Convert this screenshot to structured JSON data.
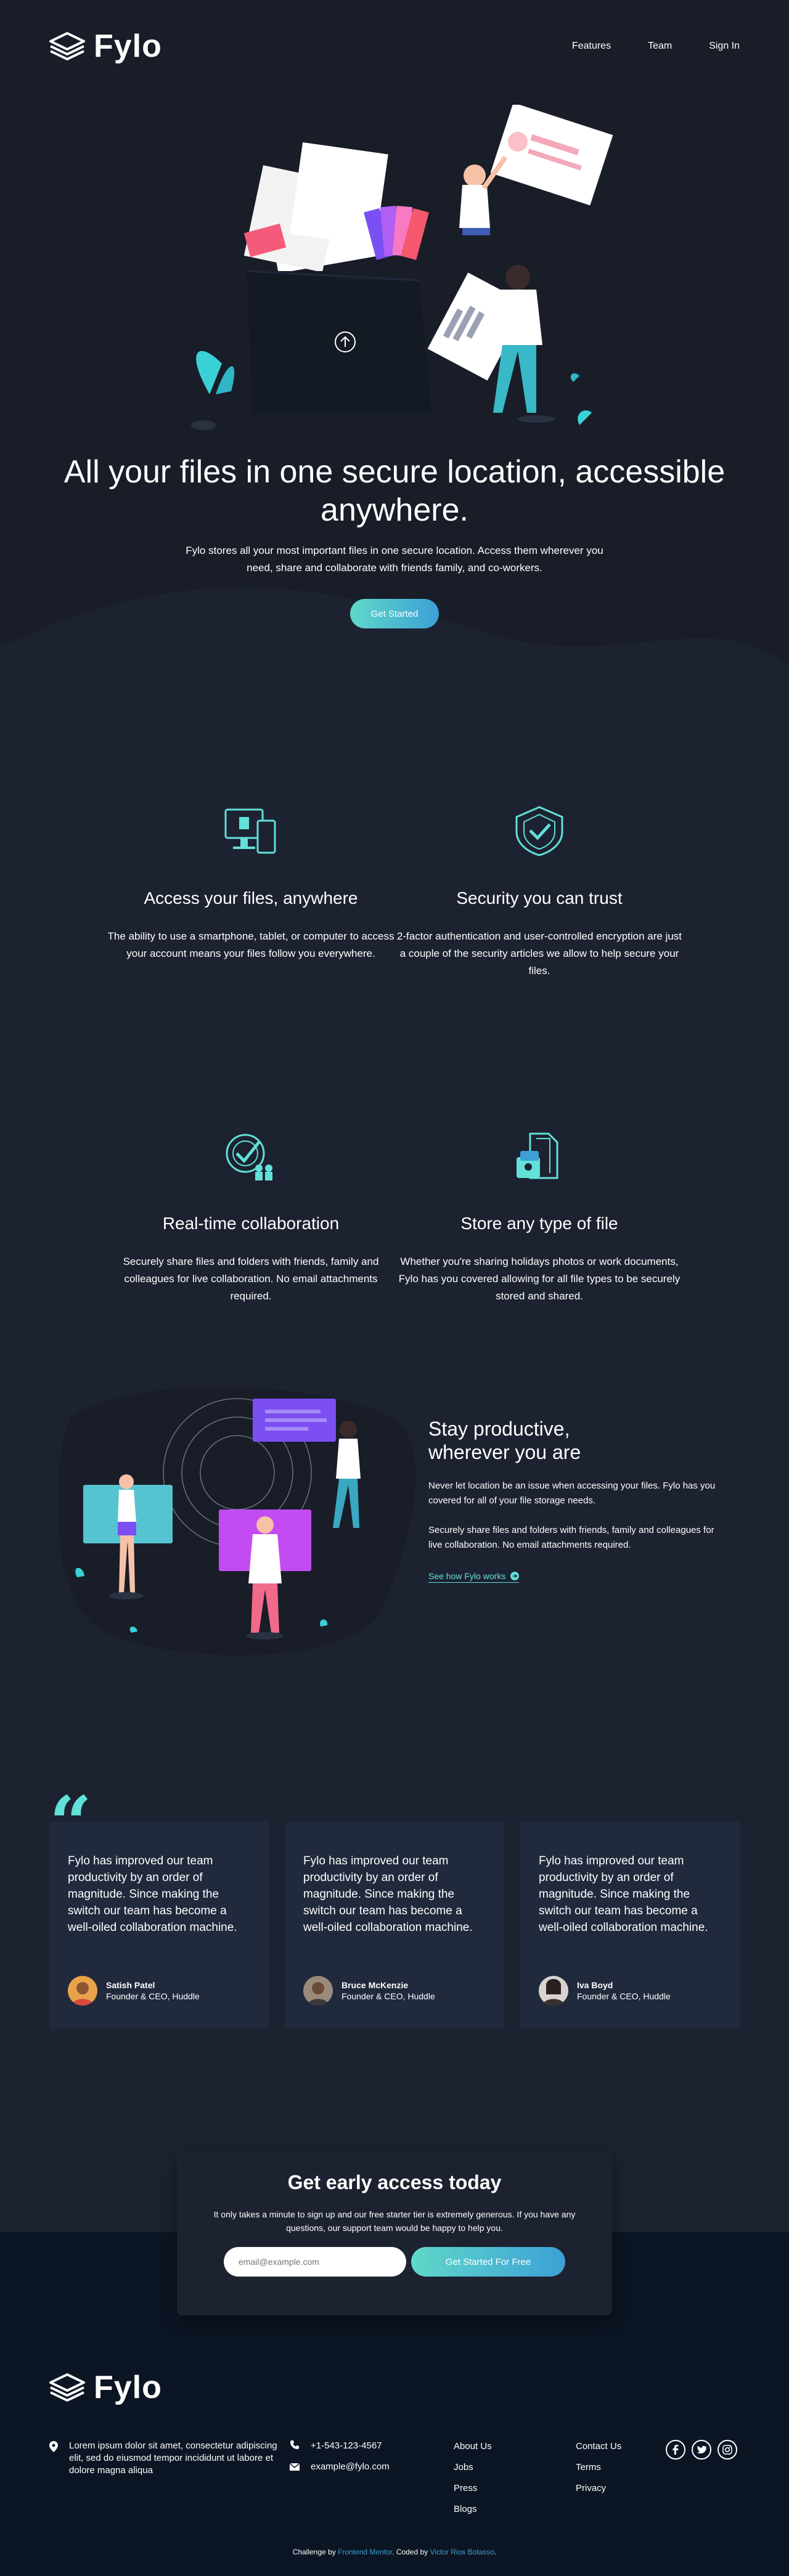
{
  "brand": {
    "name": "Fylo"
  },
  "nav": {
    "features": "Features",
    "team": "Team",
    "signin": "Sign In"
  },
  "hero": {
    "title": "All your files in one secure location, accessible anywhere.",
    "text": "Fylo stores all your most important files in one secure location. Access them wherever you need, share and collaborate with friends family, and co-workers.",
    "cta": "Get Started"
  },
  "features": [
    {
      "icon": "access-anywhere-icon",
      "title": "Access your files, anywhere",
      "text": "The ability to use a smartphone, tablet, or computer to access your account means your files follow you everywhere."
    },
    {
      "icon": "security-icon",
      "title": "Security you can trust",
      "text": "2-factor authentication and user-controlled encryption are just a couple of the security articles we allow to help secure your files."
    },
    {
      "icon": "collaboration-icon",
      "title": "Real-time collaboration",
      "text": "Securely share files and folders with friends, family and colleagues for live collaboration. No email attachments required."
    },
    {
      "icon": "any-file-icon",
      "title": "Store any type of file",
      "text": "Whether you're sharing holidays photos or work documents, Fylo has you covered allowing for all file types to be securely stored and shared."
    }
  ],
  "productive": {
    "title_line1": "Stay productive,",
    "title_line2": "wherever you are",
    "p1": "Never let location be an issue when accessing your files. Fylo has you covered for all of your file storage needs.",
    "p2": "Securely share files and folders with friends, family and colleagues for live collaboration. No email attachments required.",
    "link": "See how Fylo works"
  },
  "testimonials": [
    {
      "quote": "Fylo has improved our team productivity by an order of magnitude. Since making the switch our team has become a well-oiled collaboration machine.",
      "name": "Satish Patel",
      "role": "Founder & CEO, Huddle"
    },
    {
      "quote": "Fylo has improved our team productivity by an order of magnitude. Since making the switch our team has become a well-oiled collaboration machine.",
      "name": "Bruce McKenzie",
      "role": "Founder & CEO, Huddle"
    },
    {
      "quote": "Fylo has improved our team productivity by an order of magnitude. Since making the switch our team has become a well-oiled collaboration machine.",
      "name": "Iva Boyd",
      "role": "Founder & CEO, Huddle"
    }
  ],
  "cta": {
    "title": "Get early access today",
    "text": "It only takes a minute to sign up and our free starter tier is extremely generous. If you have any questions, our support team would be happy to help you.",
    "placeholder": "email@example.com",
    "button": "Get Started For Free"
  },
  "footer": {
    "address": "Lorem ipsum dolor sit amet, consectetur adipiscing elit, sed do eiusmod tempor incididunt ut labore et dolore magna aliqua",
    "phone": "+1-543-123-4567",
    "email": "example@fylo.com",
    "links_col1": [
      "About Us",
      "Jobs",
      "Press",
      "Blogs"
    ],
    "links_col2": [
      "Contact Us",
      "Terms",
      "Privacy"
    ],
    "credit_prefix": "Challenge by ",
    "credit_fm": "Frontend Mentor",
    "credit_mid": ". Coded by ",
    "credit_author": "Victor Rios Botasso",
    "credit_end": "."
  },
  "colors": {
    "bg": "#1c2230",
    "hero_bg": "#181d28",
    "footer_bg": "#0c1523",
    "card": "#21293c",
    "accent_cyan": "#62e0d9",
    "accent_blue": "#3ca0d6"
  }
}
